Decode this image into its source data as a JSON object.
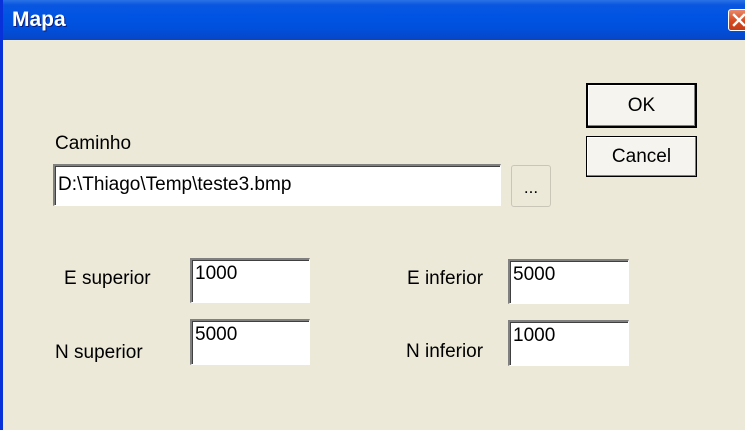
{
  "window": {
    "title": "Mapa"
  },
  "buttons": {
    "ok": "OK",
    "cancel": "Cancel",
    "browse": "..."
  },
  "path": {
    "label": "Caminho",
    "value": "D:\\Thiago\\Temp\\teste3.bmp"
  },
  "coords": {
    "e_superior": {
      "label": "E superior",
      "value": "1000"
    },
    "e_inferior": {
      "label": "E inferior",
      "value": "5000"
    },
    "n_superior": {
      "label": "N superior",
      "value": "5000"
    },
    "n_inferior": {
      "label": "N inferior",
      "value": "1000"
    }
  },
  "icons": {
    "close": "close-icon"
  }
}
